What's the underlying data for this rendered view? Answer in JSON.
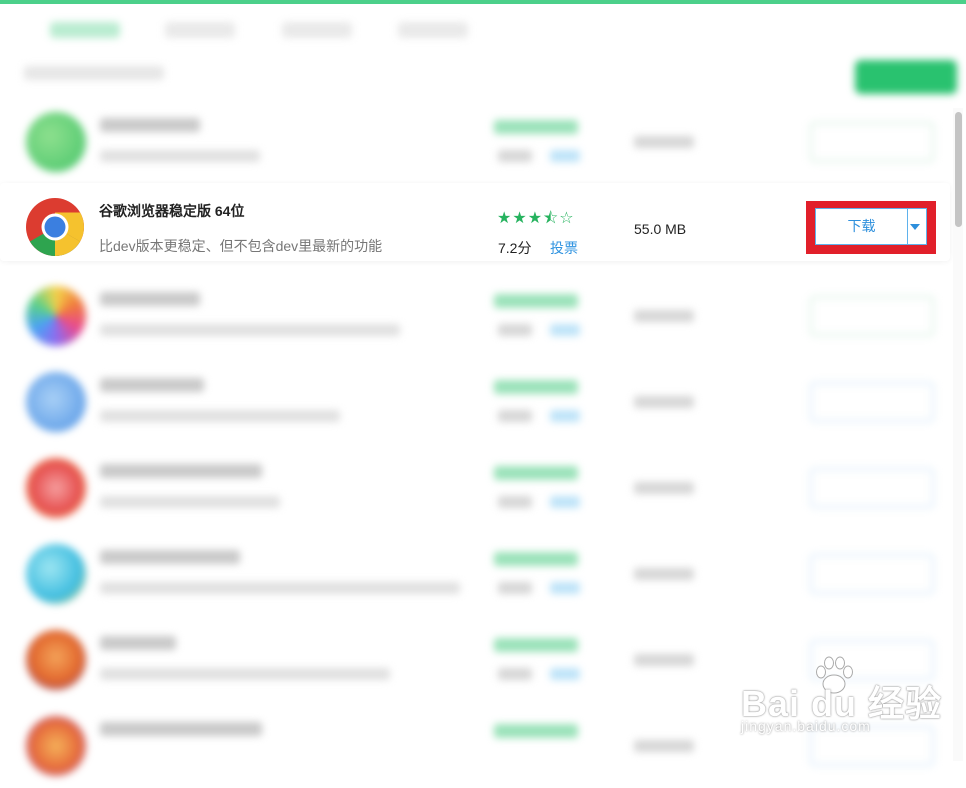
{
  "featured": {
    "title": "谷歌浏览器稳定版 64位",
    "description": "比dev版本更稳定、但不包含dev里最新的功能",
    "rating_stars": 3.5,
    "score": "7.2分",
    "vote_label": "投票",
    "size": "55.0 MB",
    "download_label": "下载"
  },
  "watermark": {
    "brand": "Bai  du 经验",
    "url": "jingyan.baidu.com"
  },
  "colors": {
    "accent_green": "#27b35f",
    "link_blue": "#2f93e0",
    "highlight_red": "#e11f2a"
  }
}
